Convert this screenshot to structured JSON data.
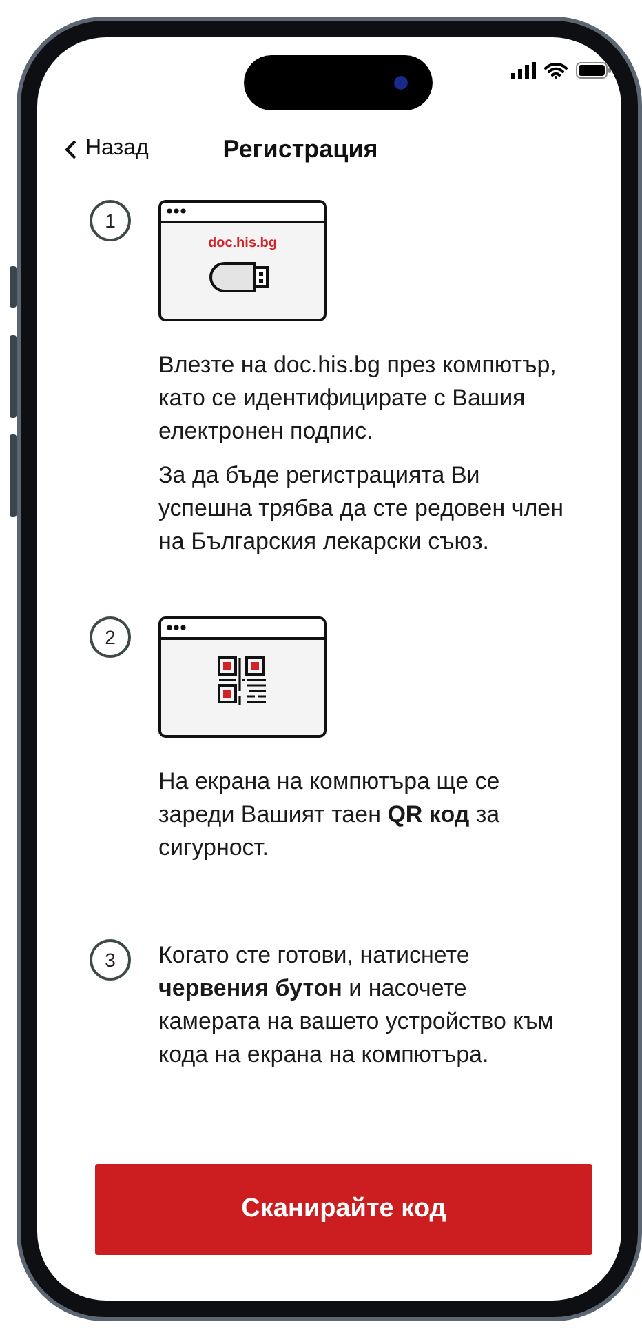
{
  "nav": {
    "back": "Назад",
    "title": "Регистрация"
  },
  "steps": [
    {
      "number": "1",
      "kind": "usb",
      "illustration_text": "doc.his.bg",
      "paragraphs": [
        "Влезте на doc.his.bg през компютър, като се идентифицирате с Вашия електронен подпис.",
        "За да бъде регистрацията Ви успешна трябва да сте редовен член на Българския лекарски съюз."
      ]
    },
    {
      "number": "2",
      "kind": "qr",
      "paragraphs": [
        "На екрана на компютъра ще се зареди Вашият таен **QR код** за сигурност."
      ]
    },
    {
      "number": "3",
      "kind": "none",
      "paragraphs": [
        "Когато сте готови, натиснете **червения бутон** и насочете камерата на вашето устройство към кода на екрана на компютъра."
      ]
    }
  ],
  "button": "Сканирайте код"
}
